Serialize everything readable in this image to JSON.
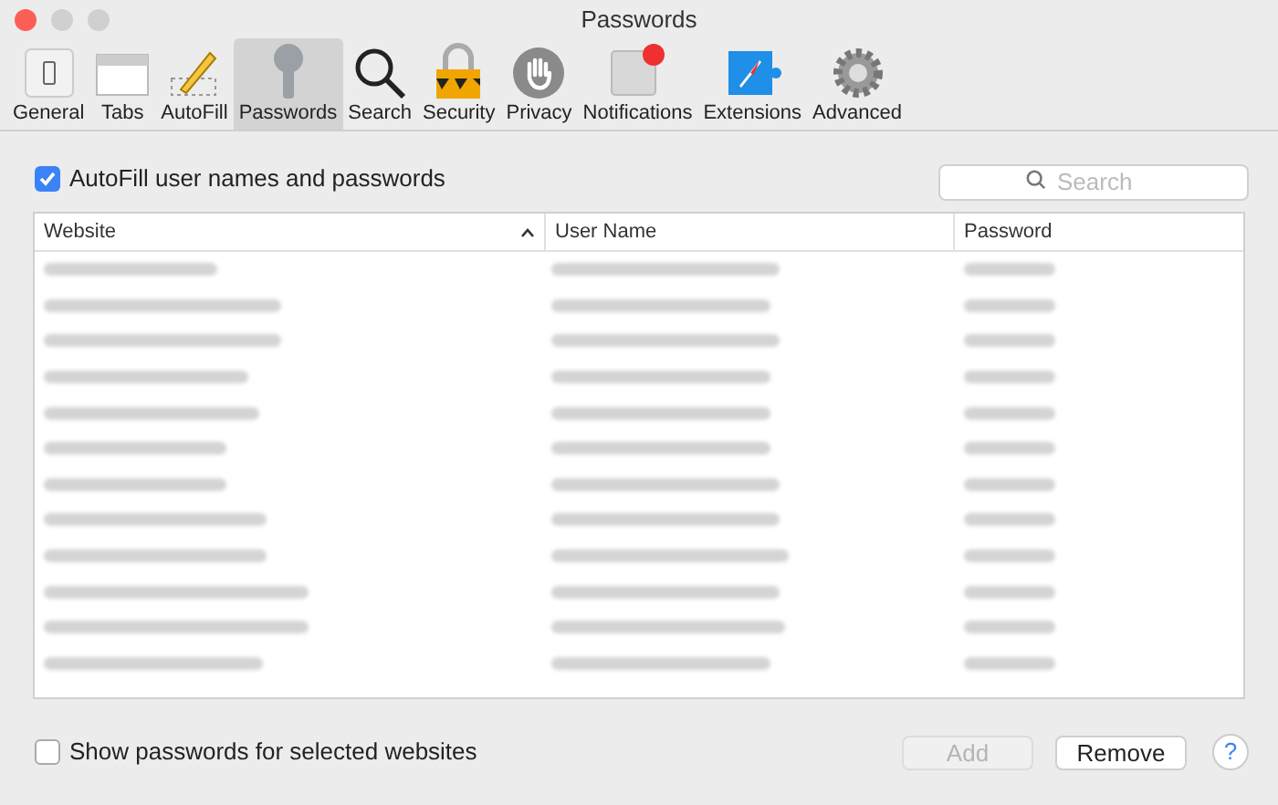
{
  "window": {
    "title": "Passwords"
  },
  "toolbar": [
    {
      "label": "General",
      "kind": "general",
      "selected": false
    },
    {
      "label": "Tabs",
      "kind": "tabs",
      "selected": false
    },
    {
      "label": "AutoFill",
      "kind": "autofill",
      "selected": false
    },
    {
      "label": "Passwords",
      "kind": "passwords",
      "selected": true
    },
    {
      "label": "Search",
      "kind": "search",
      "selected": false
    },
    {
      "label": "Security",
      "kind": "security",
      "selected": false
    },
    {
      "label": "Privacy",
      "kind": "privacy",
      "selected": false
    },
    {
      "label": "Notifications",
      "kind": "notifications",
      "selected": false
    },
    {
      "label": "Extensions",
      "kind": "extensions",
      "selected": false
    },
    {
      "label": "Advanced",
      "kind": "advanced",
      "selected": false
    }
  ],
  "autofill": {
    "label": "AutoFill user names and passwords",
    "checked": true
  },
  "search": {
    "placeholder": "Search"
  },
  "table": {
    "columns": [
      {
        "label": "Website",
        "sorted": true
      },
      {
        "label": "User Name",
        "sorted": false
      },
      {
        "label": "Password",
        "sorted": false
      }
    ]
  },
  "show_passwords": {
    "label": "Show passwords for selected websites",
    "checked": false
  },
  "buttons": [
    {
      "label": "Add",
      "disabled": true
    },
    {
      "label": "Remove",
      "disabled": false
    }
  ],
  "help": {
    "label": "?"
  }
}
